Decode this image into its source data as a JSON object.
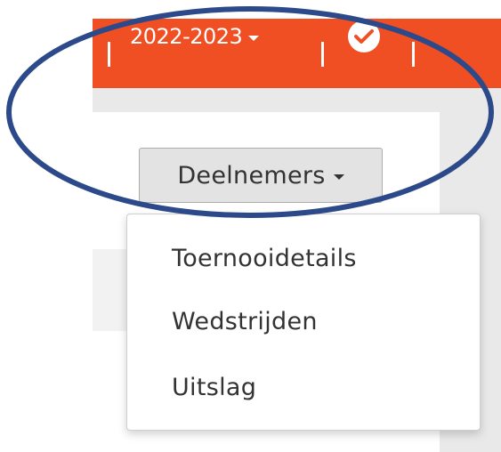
{
  "header": {
    "season_label": "2022-2023",
    "season_caret_icon": "caret-down-icon",
    "status_icon": "check-circle-icon"
  },
  "dropdown": {
    "button_label": "Deelnemers",
    "caret_icon": "caret-down-icon",
    "items": [
      {
        "label": "Toernooidetails"
      },
      {
        "label": "Wedstrijden"
      },
      {
        "label": "Uitslag"
      }
    ]
  },
  "colors": {
    "header_orange": "#f04e23",
    "annotation_blue": "#2c4a8a",
    "text_dark": "#333333"
  }
}
